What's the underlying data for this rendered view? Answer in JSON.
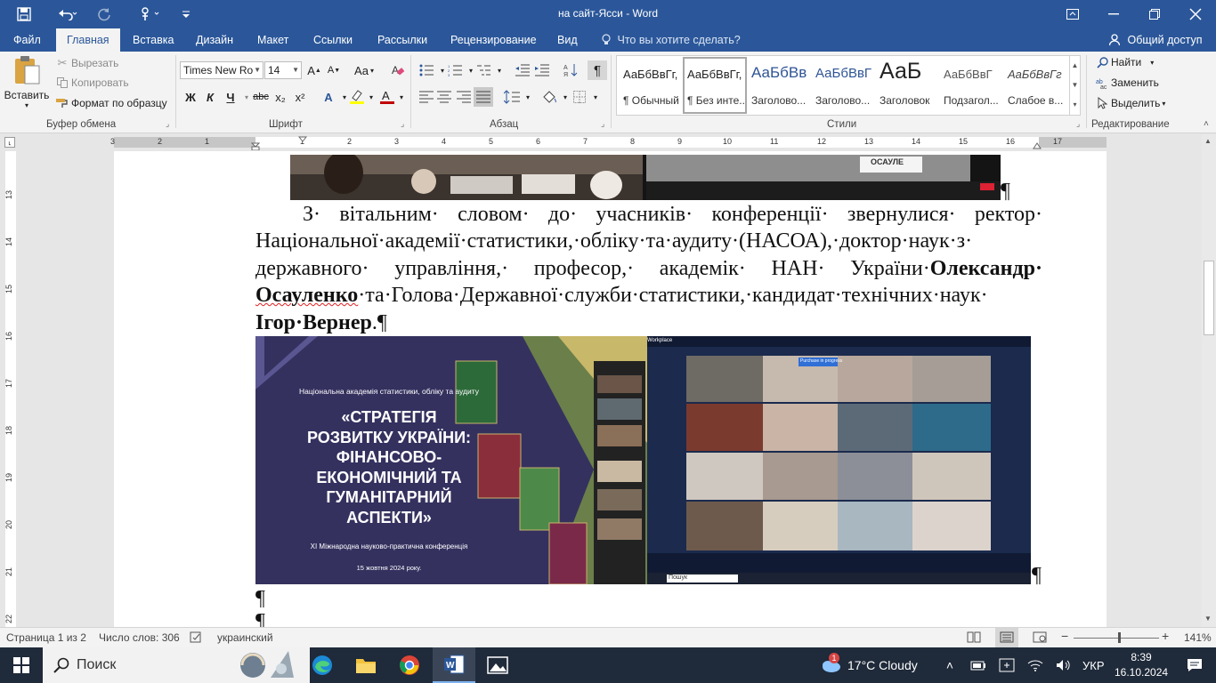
{
  "titlebar": {
    "title": "на сайт-Ясси  -  Word",
    "icons": [
      "save-icon",
      "undo-icon",
      "redo-icon",
      "touch-mode-icon",
      "customize-qat-icon"
    ],
    "controls": [
      "ribbon-display-icon",
      "minimize-icon",
      "restore-icon",
      "close-icon"
    ]
  },
  "tabs": {
    "items": [
      "Файл",
      "Главная",
      "Вставка",
      "Дизайн",
      "Макет",
      "Ссылки",
      "Рассылки",
      "Рецензирование",
      "Вид"
    ],
    "active": "Главная",
    "tellme": "Что вы хотите сделать?",
    "share": "Общий доступ"
  },
  "ribbon": {
    "clipboard": {
      "label": "Буфер обмена",
      "paste": "Вставить",
      "cut": "Вырезать",
      "copy": "Копировать",
      "format_painter": "Формат по образцу"
    },
    "font": {
      "label": "Шрифт",
      "name": "Times New Ro",
      "size": "14",
      "case": "Aa",
      "bold": "Ж",
      "italic": "К",
      "underline": "Ч",
      "strike": "abc",
      "sub": "x₂",
      "sup": "x²",
      "font_color": "#c00000",
      "highlight_color": "#ffff00"
    },
    "paragraph": {
      "label": "Абзац",
      "pilcrow": "¶"
    },
    "styles": {
      "label": "Стили",
      "items": [
        {
          "preview": "АаБбВвГг,",
          "name": "¶ Обычный"
        },
        {
          "preview": "АаБбВвГг,",
          "name": "¶ Без инте..."
        },
        {
          "preview": "АаБбВв",
          "name": "Заголово..."
        },
        {
          "preview": "АаБбВвГ",
          "name": "Заголово..."
        },
        {
          "preview": "АаБ",
          "name": "Заголовок"
        },
        {
          "preview": "АаБбВвГ",
          "name": "Подзагол..."
        },
        {
          "preview": "АаБбВвГг",
          "name": "Слабое в..."
        }
      ],
      "selected_index": 1
    },
    "editing": {
      "label": "Редактирование",
      "find": "Найти",
      "replace": "Заменить",
      "select": "Выделить"
    }
  },
  "ruler": {
    "numbers": [
      "3",
      "2",
      "1",
      "1",
      "2",
      "3",
      "4",
      "5",
      "6",
      "7",
      "8",
      "9",
      "10",
      "11",
      "12",
      "13",
      "14",
      "15",
      "16",
      "17"
    ],
    "vertical": [
      "13",
      "14",
      "15",
      "16",
      "17",
      "18",
      "19",
      "20",
      "21",
      "22"
    ]
  },
  "document": {
    "pilcrow": "¶",
    "paragraph": {
      "part1": "З· вітальним· словом· до· учасників· конференції· звернулися· ректор· Національної·академії·статистики,·обліку·та·аудиту·(НАСОА),·доктор·наук·з· державного· управління,· професор,· академік· НАН· України·",
      "bold1": "Олександр· ",
      "bold2": "Осауленко",
      "part2": "·та·Голова·Державної·служби·статистики,·кандидат·технічних·наук· ",
      "bold3": "Ігор·Вернер",
      "part3": ".¶"
    },
    "image_top": {
      "nameplate": "ОСАУЛЕ"
    },
    "image_main": {
      "org": "Національна академія статистики, обліку та аудиту",
      "title_lines": [
        "«СТРАТЕГІЯ",
        "РОЗВИТКУ УКРАЇНИ:",
        "ФІНАНСОВО-",
        "ЕКОНОМІЧНИЙ ТА",
        "ГУМАНІТАРНИЙ",
        "АСПЕКТИ»"
      ],
      "subtitle": "XI Міжнародна науково-практична конференція",
      "date": "15 жовтня 2024 року.",
      "zoom_app": "Workplace",
      "zoom_banner": "Purchase in progress",
      "search": "Пошук"
    }
  },
  "status": {
    "page": "Страница 1 из 2",
    "words": "Число слов: 306",
    "language": "украинский",
    "zoom": "141%"
  },
  "taskbar": {
    "search": "Поиск",
    "weather": "17°C  Cloudy",
    "weather_badge": "1",
    "lang": "УКР",
    "time": "8:39",
    "date": "16.10.2024"
  }
}
